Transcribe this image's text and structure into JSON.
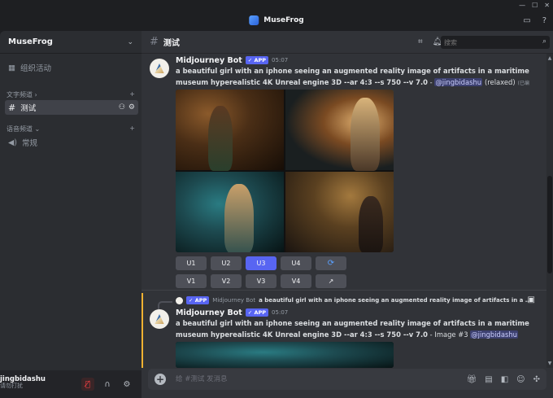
{
  "titlebar": {
    "title": "MuseFrog",
    "controls": [
      "—",
      "☐",
      "✕"
    ],
    "inbox_icon": "inbox-icon",
    "help_icon": "help-icon"
  },
  "sidebar": {
    "server_name": "MuseFrog",
    "items": [
      {
        "label": "组织活动",
        "icon": "calendar-icon"
      },
      {
        "category": "文字频道"
      },
      {
        "label": "测试",
        "icon": "hash-icon",
        "active": true
      },
      {
        "category": "语音频道"
      },
      {
        "label": "常规",
        "icon": "speaker-icon"
      }
    ]
  },
  "user": {
    "name": "jingbidashu",
    "status": "请勿打扰"
  },
  "channel": {
    "name": "测试",
    "search_placeholder": "搜索"
  },
  "messages": [
    {
      "author": "Midjourney Bot",
      "tag": "APP",
      "time": "05:07",
      "prompt": "a beautiful girl with an iphone seeing an augmented reality image of artifacts in a maritime museum hyperealistic 4K Unreal engine 3D --ar 4:3 --s 750 --v 7.0",
      "separator": " - ",
      "mention": "@jingbidashu",
      "suffix": "(relaxed)",
      "note": "(已编辑)",
      "buttons_row1": [
        "U1",
        "U2",
        "U3",
        "U4"
      ],
      "buttons_row2": [
        "V1",
        "V2",
        "V3",
        "V4"
      ],
      "active_button": "U3"
    },
    {
      "reply_author": "Midjourney Bot",
      "reply_tag": "APP",
      "reply_text": "a beautiful girl with an iphone seeing an augmented reality image of artifacts in a maritime ...",
      "author": "Midjourney Bot",
      "tag": "APP",
      "time": "05:07",
      "prompt": "a beautiful girl with an iphone seeing an augmented reality image of artifacts in a maritime museum hyperealistic 4K Unreal engine 3D --ar 4:3 --s 750 --v 7.0",
      "suffix": " - Image #3 ",
      "mention": "@jingbidashu"
    }
  ],
  "composer": {
    "placeholder": "给 #测试 发消息"
  },
  "colors": {
    "accent": "#5865f2",
    "bg": "#313338",
    "sidebar": "#2b2d31",
    "muted_red": "#f23f43"
  }
}
